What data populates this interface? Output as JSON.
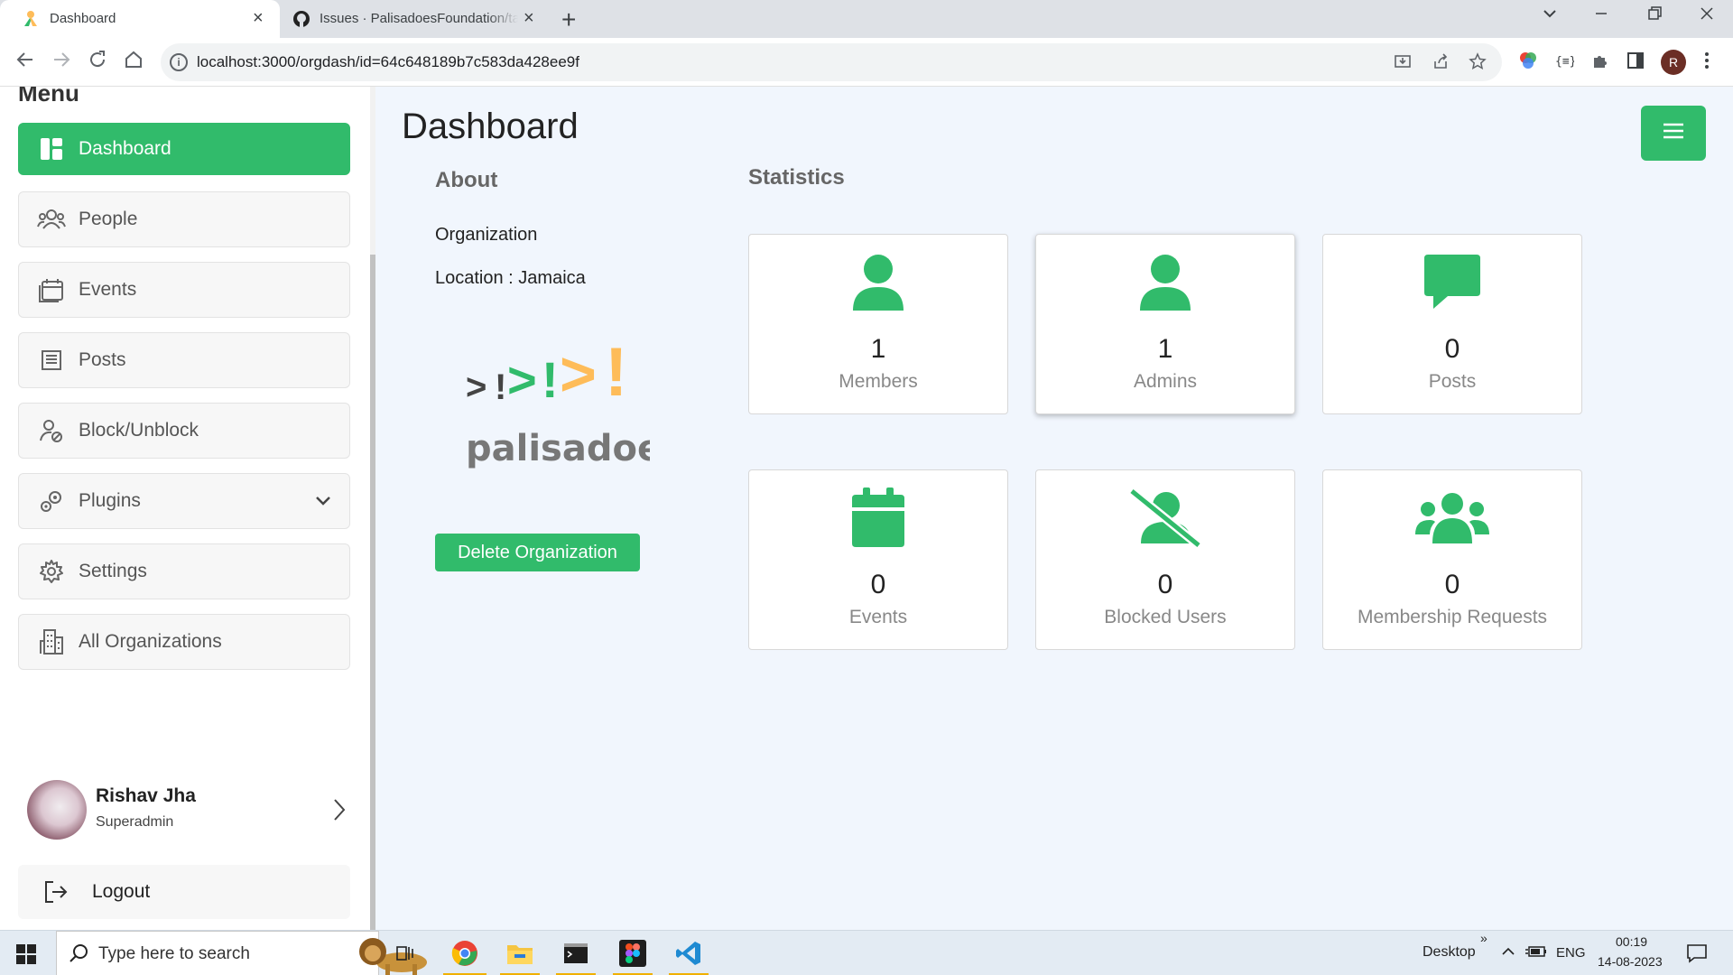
{
  "browser": {
    "tabs": [
      {
        "title": "Dashboard",
        "active": true
      },
      {
        "title": "Issues · PalisadoesFoundation/talawa-admin",
        "active": false
      }
    ],
    "url": "localhost:3000/orgdash/id=64c648189b7c583da428ee9f",
    "profile_initial": "R",
    "new_tab_glyph": "+",
    "close_glyph": "×"
  },
  "sidebar": {
    "menu_title": "Menu",
    "items": [
      {
        "label": "Dashboard",
        "icon": "dashboard-icon",
        "active": true
      },
      {
        "label": "People",
        "icon": "people-icon"
      },
      {
        "label": "Events",
        "icon": "events-icon"
      },
      {
        "label": "Posts",
        "icon": "posts-icon"
      },
      {
        "label": "Block/Unblock",
        "icon": "block-user-icon"
      },
      {
        "label": "Plugins",
        "icon": "plugins-icon",
        "has_dropdown": true
      },
      {
        "label": "Settings",
        "icon": "gear-icon"
      },
      {
        "label": "All Organizations",
        "icon": "organizations-icon"
      }
    ],
    "user": {
      "name": "Rishav Jha",
      "role": "Superadmin"
    },
    "logout_label": "Logout"
  },
  "main": {
    "title": "Dashboard",
    "about": {
      "title": "About",
      "name": "Organization",
      "location": "Location : Jamaica",
      "logo_text": "palisadoes",
      "logo_mark": [
        ">",
        "!",
        ">",
        "!",
        ">",
        "!"
      ],
      "delete_label": "Delete Organization"
    },
    "statistics": {
      "title": "Statistics",
      "cards": [
        {
          "value": "1",
          "label": "Members",
          "icon": "user-icon"
        },
        {
          "value": "1",
          "label": "Admins",
          "icon": "user-icon"
        },
        {
          "value": "0",
          "label": "Posts",
          "icon": "comment-icon"
        },
        {
          "value": "0",
          "label": "Events",
          "icon": "calendar-icon"
        },
        {
          "value": "0",
          "label": "Blocked Users",
          "icon": "user-slash-icon"
        },
        {
          "value": "0",
          "label": "Membership Requests",
          "icon": "users-icon"
        }
      ]
    }
  },
  "taskbar": {
    "search_placeholder": "Type here to search",
    "desktop_label": "Desktop",
    "overflow_glyph": "»",
    "language": "ENG",
    "time": "00:19",
    "date": "14-08-2023"
  },
  "colors": {
    "accent": "#31bb6b",
    "page_bg": "#f1f6fd"
  }
}
